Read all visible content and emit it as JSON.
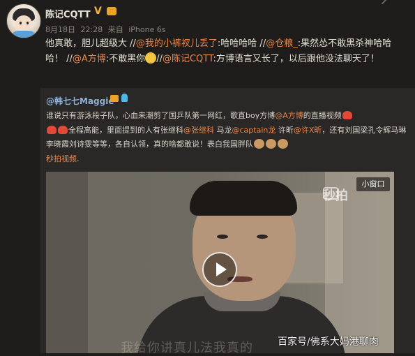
{
  "author": {
    "name": "陈记CQTT",
    "verified": "V"
  },
  "meta": {
    "date": "8月18日",
    "time": "22:28",
    "source_prefix": "来自",
    "device": "iPhone 6s"
  },
  "post": {
    "line1_start": "他真敢，胆儿超级大 //",
    "mention1": "@我的小裤衩儿丢了",
    "line1_mid": ":哈哈哈哈 //",
    "mention2": "@仓粮_",
    "line1_end": ":果然怂不敢黑杀神哈哈哈！ //",
    "mention3": "@A方博",
    "line2_mid": ":不敢黑你",
    "line2_after": "//",
    "mention4": "@陈记CQTT",
    "line2_end": ":方博语言又长了，以后跟他没法聊天了！"
  },
  "repost": {
    "author": "@韩七七Maggie",
    "text1": "谁说只有游泳段子队，心血来潮剪了国乒队第一网红，歌直boy方博",
    "mention_a": "@A方博",
    "text2": "的直播视频",
    "text3": "全程高能，里面提到的人有张继科",
    "mention_b": "@张继科",
    "text4": "马龙",
    "mention_c": "@captain龙",
    "text5": "许昕",
    "mention_d": "@许X昕",
    "text6": "，还有刘国梁孔令辉马琳李晓霞刘诗雯等等，各自认领，真的啥都敢说！表白我国胖队",
    "video_link": "秒拍视频"
  },
  "video": {
    "mini_window": "小窗口",
    "logo_text": "秒拍",
    "subtitle": "我给你讲真儿法我真的",
    "watermark": "百家号/佛系大妈港聊肉"
  },
  "icons": {
    "more": "chevron-down-icon",
    "play": "play-icon",
    "camera": "camera-icon"
  }
}
